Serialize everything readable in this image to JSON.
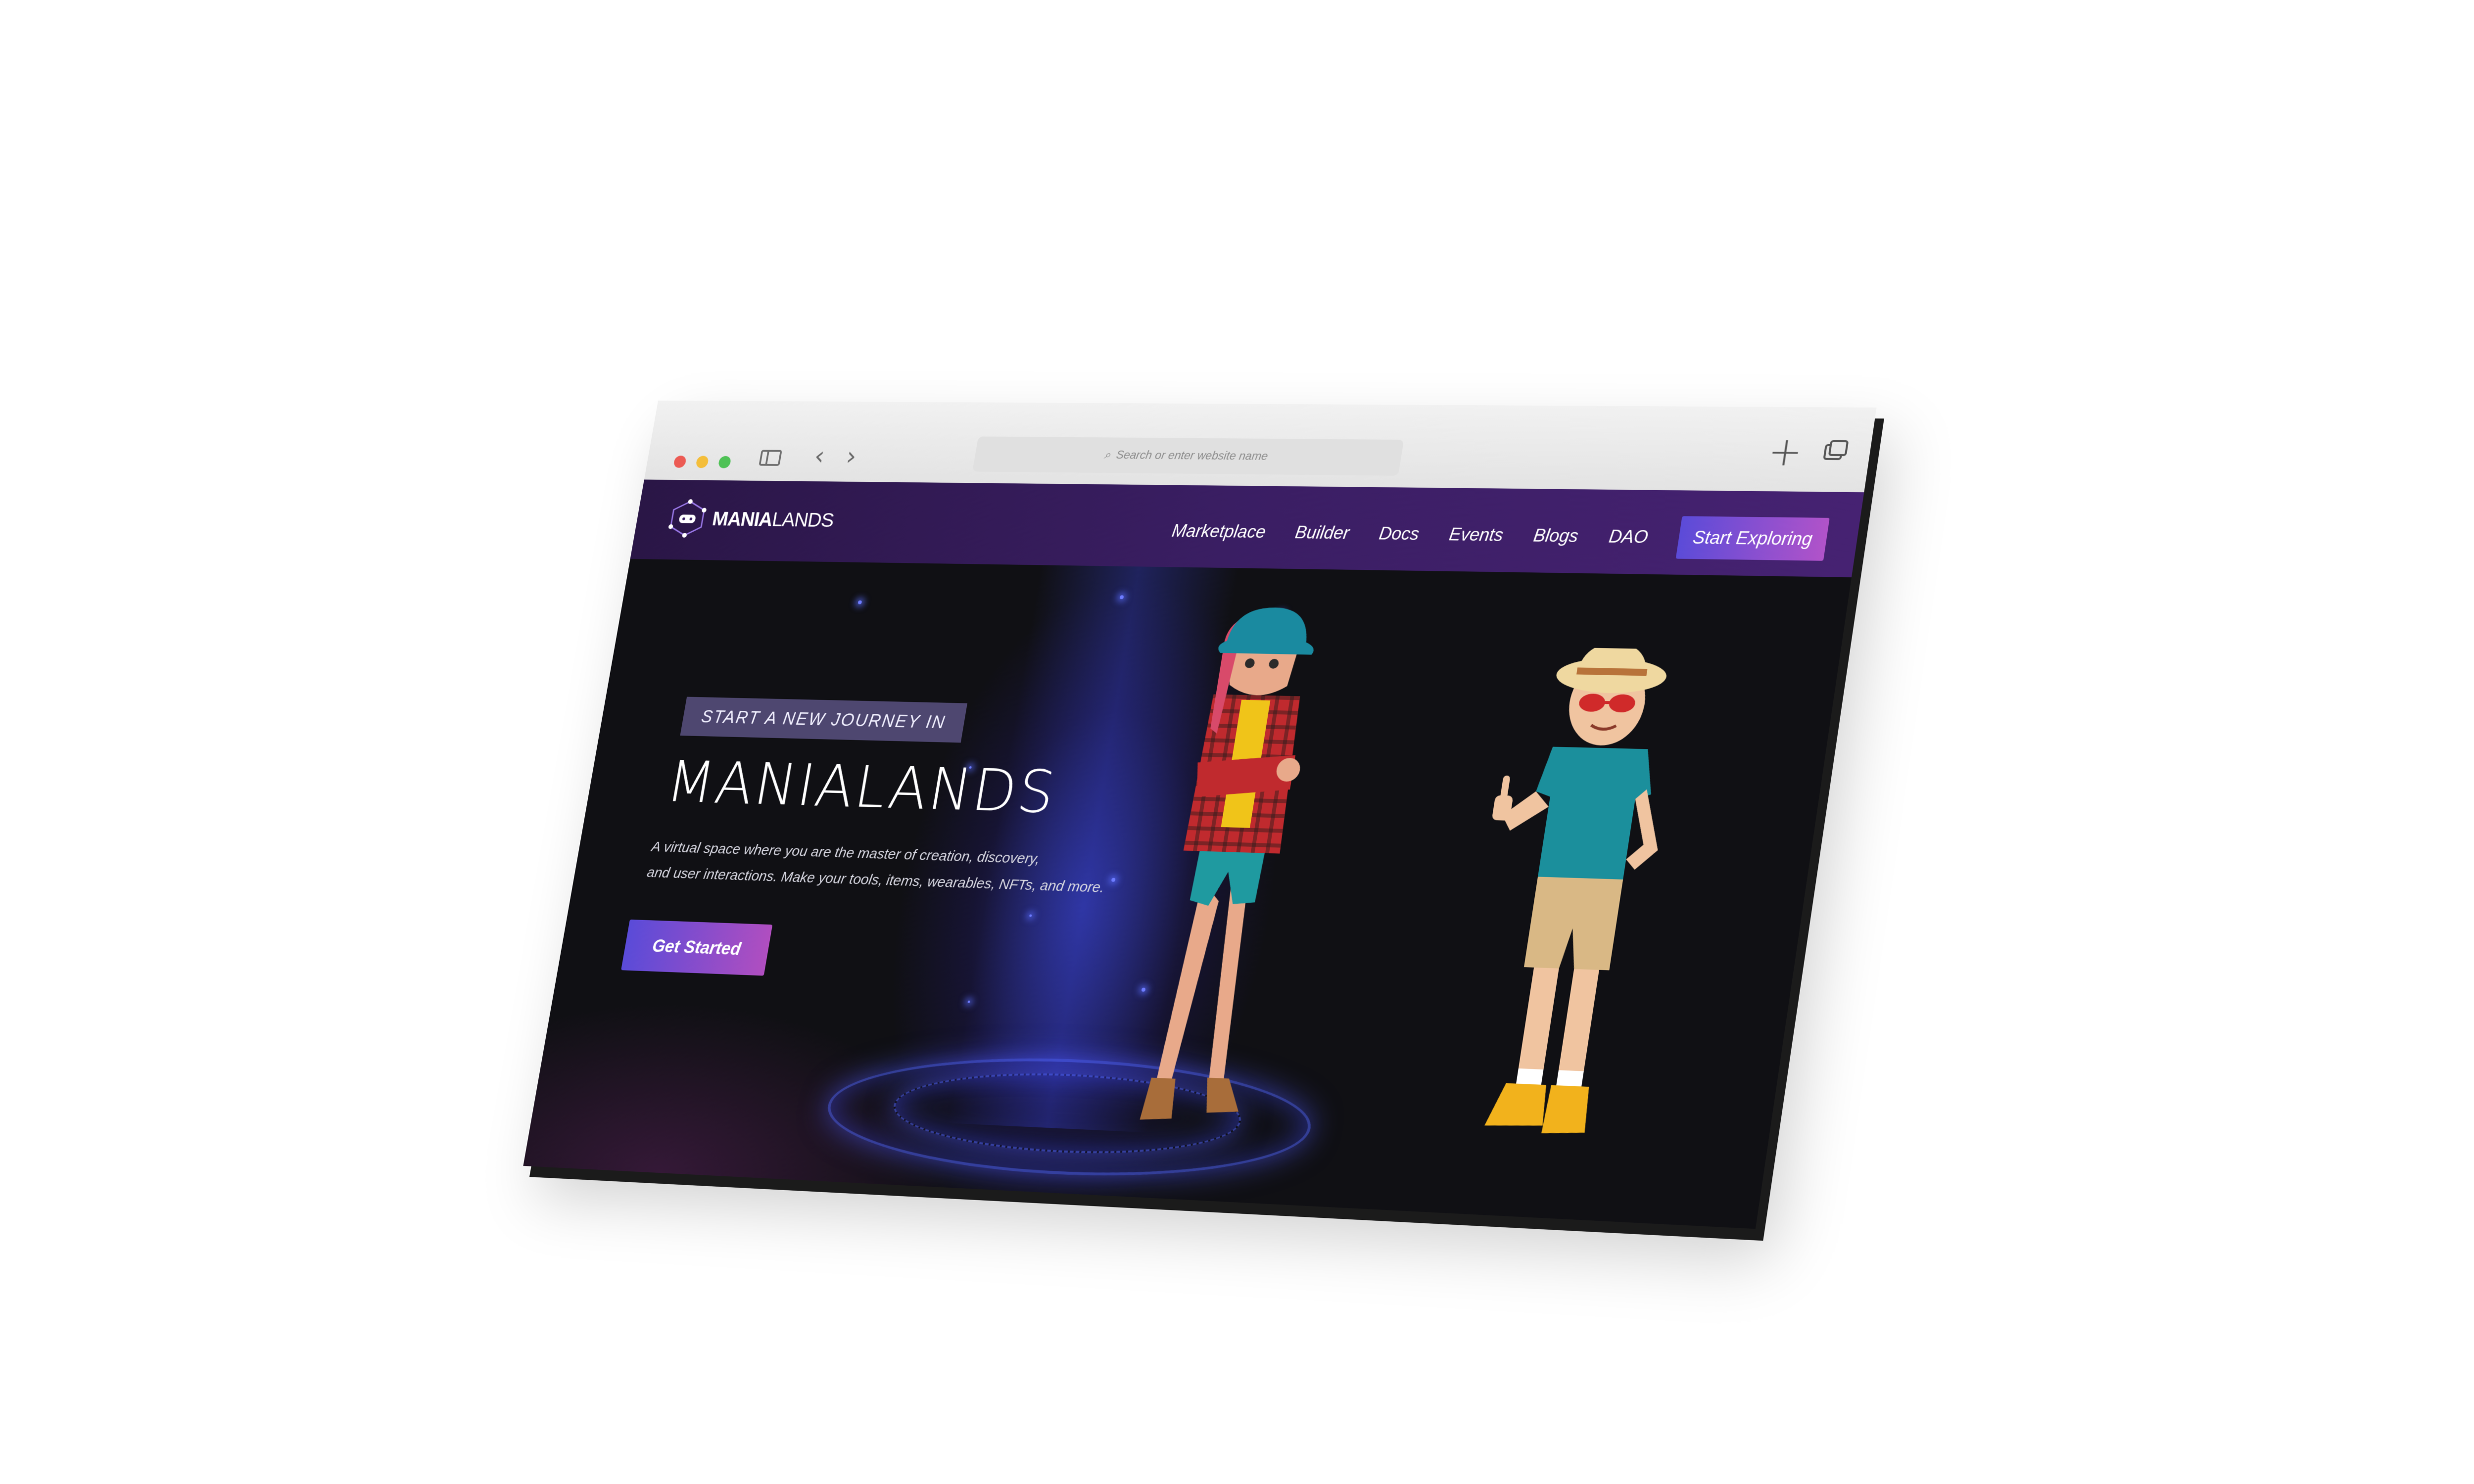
{
  "browser": {
    "address_placeholder": "Search or enter website name"
  },
  "site": {
    "logo": {
      "bold": "MANIA",
      "light": "LANDS"
    },
    "nav": [
      {
        "label": "Marketplace"
      },
      {
        "label": "Builder"
      },
      {
        "label": "Docs"
      },
      {
        "label": "Events"
      },
      {
        "label": "Blogs"
      },
      {
        "label": "DAO"
      }
    ],
    "nav_cta": "Start Exploring"
  },
  "hero": {
    "tagline": "START A NEW JOURNEY IN",
    "title": "MANIALANDS",
    "desc_line1": "A virtual space where you are the master of creation, discovery,",
    "desc_line2": "and user interactions. Make your tools, items, wearables, NFTs, and more.",
    "cta": "Get Started"
  },
  "colors": {
    "navbar": "#3a1e63",
    "cta_start": "#5b4bd8",
    "cta_end": "#b153c9",
    "hero_bg": "#101014"
  },
  "icons": [
    "sidebar-toggle-icon",
    "back-arrow-icon",
    "forward-arrow-icon",
    "search-icon",
    "new-tab-icon",
    "tabs-overview-icon",
    "logo-icon"
  ]
}
